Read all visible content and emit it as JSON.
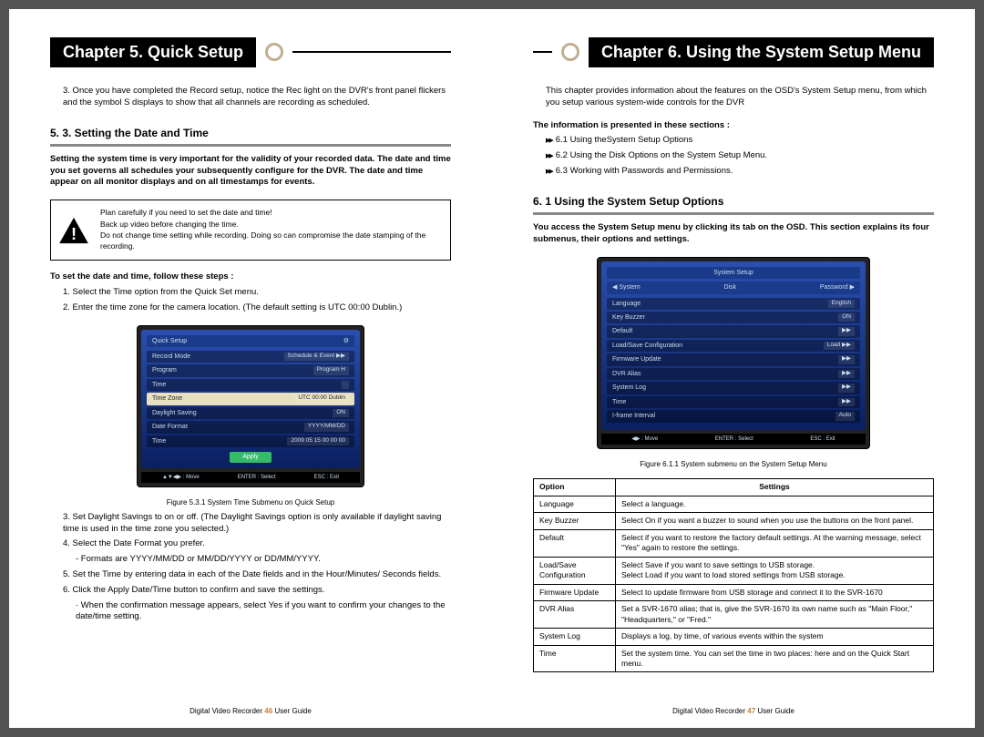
{
  "left": {
    "chapter_title": "Chapter 5. Quick Setup",
    "intro_li": "3. Once you have completed the Record setup, notice the Rec light on the DVR's front panel flickers and the symbol S displays to show that all channels are recording as scheduled.",
    "section_53": "5. 3. Setting the Date and Time",
    "section_53_body": "Setting the system time is very important for the validity of your recorded data. The date and time you set governs all schedules your subsequently configure for the DVR. The date and time appear on all monitor displays and on all timestamps for events.",
    "warn": {
      "l1": "Plan carefully if you need to set the date and time!",
      "l2": "Back up video before changing the time.",
      "l3": "Do not change time setting while recording. Doing so can compromise the date stamping of the recording."
    },
    "steps_intro": "To set the date and time, follow these steps :",
    "step1": "1. Select the Time option from the Quick Set menu.",
    "step2": "2. Enter the time zone for the camera location. (The default setting is UTC 00:00 Dublin.)",
    "ui1": {
      "title": "Quick Setup",
      "rows": [
        {
          "k": "Record Mode",
          "v": "Schedule & Event ▶▶"
        },
        {
          "k": "Program",
          "v": "Program H"
        },
        {
          "k": "Time",
          "v": ""
        },
        {
          "k": "Time Zone",
          "v": "UTC 00:00 Dublin",
          "hl": true
        },
        {
          "k": "Daylight Saving",
          "v": "ON"
        },
        {
          "k": "Date Format",
          "v": "YYYY/MM/DD"
        },
        {
          "k": "Time",
          "v": "2009 05 15  00 00 00"
        }
      ],
      "apply": "Apply",
      "bottom": [
        "▲▼◀▶ : Move",
        "ENTER : Select",
        "ESC : Exit"
      ]
    },
    "caption1": "Figure 5.3.1 System Time Submenu on Quick Setup",
    "step3": "3. Set Daylight Savings to on or off. (The Daylight Savings option is only available if daylight saving time is used in the time zone you selected.)",
    "step4": "4. Select the Date Format you prefer.",
    "step4_sub": "- Formats are YYYY/MM/DD or MM/DD/YYYY or DD/MM/YYYY.",
    "step5": "5. Set the Time by entering data in each of the Date fields and in the Hour/Minutes/ Seconds fields.",
    "step6": "6. Click the Apply Date/Time button to confirm and save the settings.",
    "step6_sub": "· When the confirmation message appears, select Yes if you want to confirm your changes to the date/time setting.",
    "footer_a": "Digital Video Recorder",
    "footer_pn": "46",
    "footer_b": "User Guide"
  },
  "right": {
    "chapter_title": "Chapter 6. Using the System Setup Menu",
    "intro": "This chapter provides information about the features on the OSD's System Setup menu, from which you setup various system-wide controls for the DVR",
    "sections_head": "The information is presented in these sections :",
    "toc": [
      "6.1 Using theSystem Setup Options",
      "6.2 Using the Disk Options on the System Setup Menu.",
      "6.3 Working with Passwords and Permissions."
    ],
    "section_61": "6. 1 Using the System Setup Options",
    "section_61_body": "You access the System Setup menu by clicking its tab on the OSD. This section explains its four submenus, their options and settings.",
    "ui2": {
      "titlebar": "System Setup",
      "tabs": [
        "◀ System",
        "Disk",
        "Password ▶"
      ],
      "rows": [
        {
          "k": "Language",
          "v": "English"
        },
        {
          "k": "Key Buzzer",
          "v": "ON"
        },
        {
          "k": "Default",
          "v": "▶▶"
        },
        {
          "k": "Load/Save Configuration",
          "v": "Load ▶▶"
        },
        {
          "k": "Firmware Update",
          "v": "▶▶"
        },
        {
          "k": "DVR Alias",
          "v": "▶▶"
        },
        {
          "k": "System Log",
          "v": "▶▶"
        },
        {
          "k": "Time",
          "v": "▶▶"
        },
        {
          "k": "I-frame Interval",
          "v": "Auto"
        }
      ],
      "bottom": [
        "◀▶ : Move",
        "ENTER : Select",
        "ESC : Exit"
      ]
    },
    "caption2": "Figure 6.1.1 System submenu on the System Setup Menu",
    "table": {
      "h1": "Option",
      "h2": "Settings",
      "rows": [
        {
          "o": "Language",
          "s": "Select a language."
        },
        {
          "o": "Key Buzzer",
          "s": "Select On if you want a buzzer to sound when you use the buttons on the front panel."
        },
        {
          "o": "Default",
          "s": "Select if you want to restore the factory default settings. At the warning message, select \"Yes\" again to restore the settings."
        },
        {
          "o": "Load/Save Configuration",
          "s": "Select Save if you want to save settings to USB storage.\nSelect Load if you want to load stored settings from USB storage."
        },
        {
          "o": "Firmware Update",
          "s": "Select to update firmware from USB storage and connect it to the SVR-1670"
        },
        {
          "o": "DVR Alias",
          "s": "Set a SVR-1670 alias; that is, give the SVR-1670 its own name such as \"Main Floor,\" \"Headquarters,\" or \"Fred.\""
        },
        {
          "o": "System Log",
          "s": "Displays a log, by time, of various events within the system"
        },
        {
          "o": "Time",
          "s": "Set the system time. You can set the time in two places: here and on the Quick Start menu."
        }
      ]
    },
    "footer_a": "Digital Video Recorder",
    "footer_pn": "47",
    "footer_b": "User Guide"
  }
}
